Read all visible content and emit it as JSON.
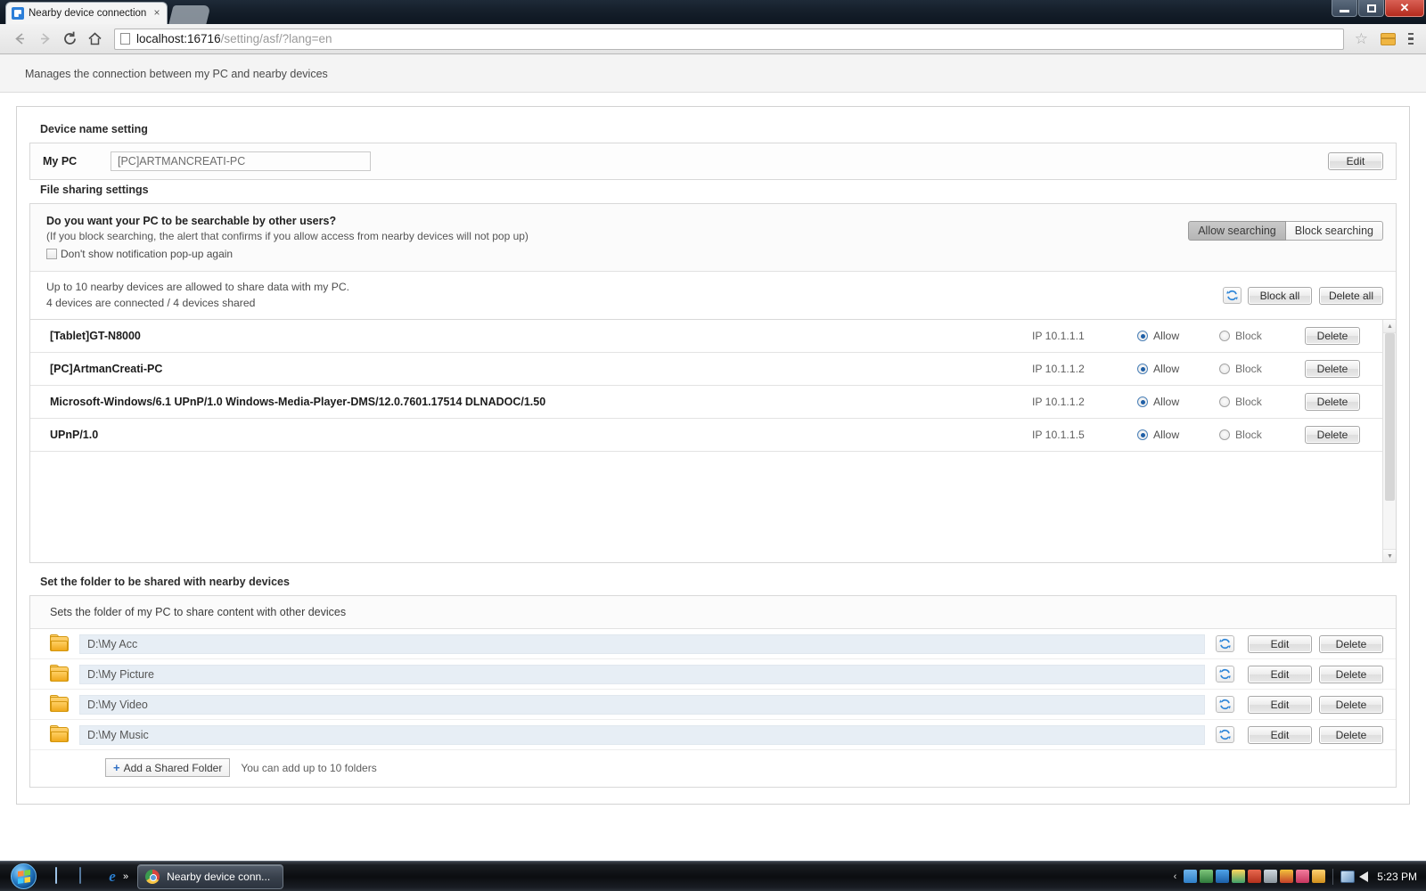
{
  "browser": {
    "tab_title": "Nearby device connection",
    "tab_close_glyph": "×",
    "url_host": "localhost:16716",
    "url_path": "/setting/asf/?lang=en",
    "back_glyph": "←",
    "forward_glyph": "→",
    "reload_glyph": "C",
    "home_glyph": "⌂",
    "star_glyph": "☆",
    "min_glyph": "—",
    "max_glyph": "❐",
    "close_glyph": "✕"
  },
  "page": {
    "description": "Manages the connection between my PC and nearby devices"
  },
  "device_name": {
    "section_title": "Device name setting",
    "label": "My PC",
    "value": "[PC]ARTMANCREATI-PC",
    "edit_label": "Edit"
  },
  "file_sharing": {
    "section_title": "File sharing settings",
    "question": "Do you want your PC to be searchable by other users?",
    "question_note": "(If you block searching, the alert that confirms if you allow access from nearby devices will not pop up)",
    "checkbox_label": "Don't show notification pop-up again",
    "checkbox_checked": false,
    "toggle": {
      "allow_label": "Allow searching",
      "block_label": "Block searching",
      "selected": "Allow searching"
    },
    "limit_line1": "Up to 10 nearby devices are allowed to share data with my PC.",
    "limit_line2": "4 devices are connected / 4 devices shared",
    "refresh_icon": "refresh-icon",
    "block_all_label": "Block all",
    "delete_all_label": "Delete all",
    "columns": {
      "allow": "Allow",
      "block": "Block",
      "delete": "Delete"
    },
    "devices": [
      {
        "name": "[Tablet]GT-N8000",
        "ip": "IP 10.1.1.1",
        "permission": "Allow"
      },
      {
        "name": "[PC]ArtmanCreati-PC",
        "ip": "IP 10.1.1.2",
        "permission": "Allow"
      },
      {
        "name": "Microsoft-Windows/6.1 UPnP/1.0 Windows-Media-Player-DMS/12.0.7601.17514 DLNADOC/1.50",
        "ip": "IP 10.1.1.2",
        "permission": "Allow"
      },
      {
        "name": "UPnP/1.0",
        "ip": "IP 10.1.1.5",
        "permission": "Allow"
      }
    ]
  },
  "folders": {
    "section_title": "Set the folder to be shared with nearby devices",
    "panel_header": "Sets the folder of my PC to share content with other devices",
    "items": [
      {
        "path": "D:\\My Acc",
        "icon": "folder-icon",
        "refresh_icon": "refresh-icon",
        "edit_label": "Edit",
        "delete_label": "Delete"
      },
      {
        "path": "D:\\My Picture",
        "icon": "folder-icon",
        "refresh_icon": "refresh-icon",
        "edit_label": "Edit",
        "delete_label": "Delete"
      },
      {
        "path": "D:\\My Video",
        "icon": "folder-icon",
        "refresh_icon": "refresh-icon",
        "edit_label": "Edit",
        "delete_label": "Delete"
      },
      {
        "path": "D:\\My Music",
        "icon": "folder-icon",
        "refresh_icon": "refresh-icon",
        "edit_label": "Edit",
        "delete_label": "Delete"
      }
    ],
    "add_label": "Add a Shared Folder",
    "add_plus": "+",
    "add_note": "You can add up to 10 folders"
  },
  "taskbar": {
    "start_label": "start-orb",
    "task_button_label": "Nearby device conn...",
    "overflow_glyph": "»",
    "tray_chevron": "‹",
    "clock": "5:23 PM"
  }
}
